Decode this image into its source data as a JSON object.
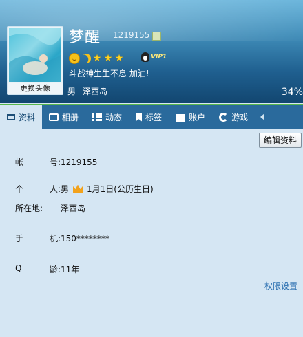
{
  "header": {
    "nickname": "梦醒",
    "qq_number": "1219155",
    "signature": "斗战神生生不息 加油!",
    "gender": "男",
    "location": "泽西岛",
    "percent": "34%",
    "avatar_button": "更换头像",
    "vip_label": "VIP1",
    "level_icons": [
      "sun-icon",
      "moon-icon",
      "star-icon",
      "star-icon",
      "star-icon"
    ]
  },
  "tabs": [
    {
      "label": "资料",
      "icon": "profile-card-icon",
      "active": true
    },
    {
      "label": "相册",
      "icon": "photo-icon"
    },
    {
      "label": "动态",
      "icon": "feed-list-icon"
    },
    {
      "label": "标签",
      "icon": "bookmark-icon"
    },
    {
      "label": "账户",
      "icon": "briefcase-icon"
    },
    {
      "label": "游戏",
      "icon": "game-icon"
    }
  ],
  "profile": {
    "edit_button": "编辑资料",
    "account": {
      "label": [
        "帐",
        "号:"
      ],
      "value": "1219155"
    },
    "personal": {
      "label": [
        "个",
        "人:"
      ],
      "gender": "男",
      "birthday": "1月1日(公历生日)"
    },
    "location": {
      "label": [
        "所在地:"
      ],
      "value": "泽西岛"
    },
    "phone": {
      "label": [
        "手",
        "机:"
      ],
      "value": "150********"
    },
    "qage": {
      "label": [
        "Q",
        "龄:"
      ],
      "value": "11年"
    },
    "permission_link": "权限设置"
  },
  "colors": {
    "tab_bar": "#2a6a9c",
    "content_bg": "#d5e6f3",
    "link": "#2a6fb0",
    "accent_line": "#58b84a"
  }
}
